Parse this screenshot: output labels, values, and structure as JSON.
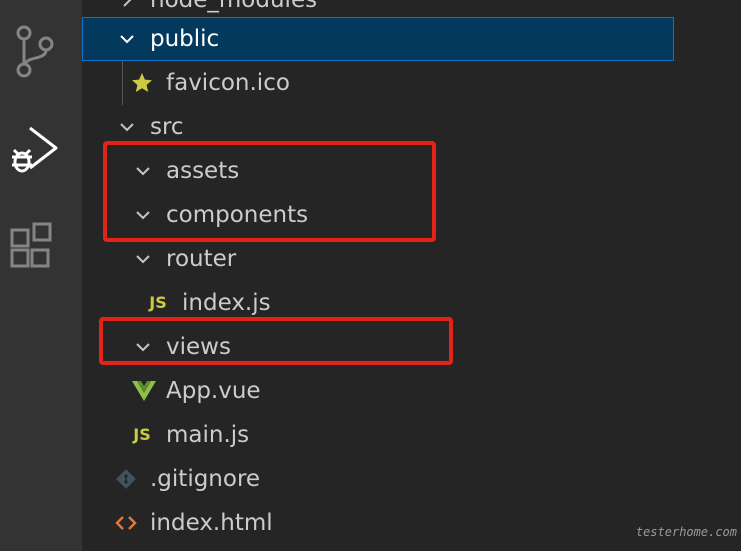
{
  "activity_bar": {
    "icons": [
      "source-control-icon",
      "run-debug-icon",
      "extensions-icon"
    ]
  },
  "explorer": {
    "rows": [
      {
        "label": "node_modules",
        "kind": "folder",
        "state": "collapsed"
      },
      {
        "label": "public",
        "kind": "folder",
        "state": "expanded",
        "selected": true
      },
      {
        "label": "favicon.ico",
        "kind": "file",
        "icon": "star-icon"
      },
      {
        "label": "src",
        "kind": "folder",
        "state": "expanded"
      },
      {
        "label": "assets",
        "kind": "folder",
        "state": "expanded"
      },
      {
        "label": "components",
        "kind": "folder",
        "state": "expanded"
      },
      {
        "label": "router",
        "kind": "folder",
        "state": "expanded"
      },
      {
        "label": "index.js",
        "kind": "file",
        "icon": "js-icon",
        "badge": "JS"
      },
      {
        "label": "views",
        "kind": "folder",
        "state": "expanded"
      },
      {
        "label": "App.vue",
        "kind": "file",
        "icon": "vue-icon"
      },
      {
        "label": "main.js",
        "kind": "file",
        "icon": "js-icon",
        "badge": "JS"
      },
      {
        "label": ".gitignore",
        "kind": "file",
        "icon": "git-icon"
      },
      {
        "label": "index.html",
        "kind": "file",
        "icon": "html-icon"
      }
    ]
  },
  "colors": {
    "background": "#252526",
    "activity_bar": "#333333",
    "selection": "#04395e",
    "highlight_box": "#e2231a",
    "js_yellow": "#cbcb41",
    "vue_green": "#8dc149",
    "html_orange": "#e37933"
  },
  "watermark": "testerhome.com"
}
